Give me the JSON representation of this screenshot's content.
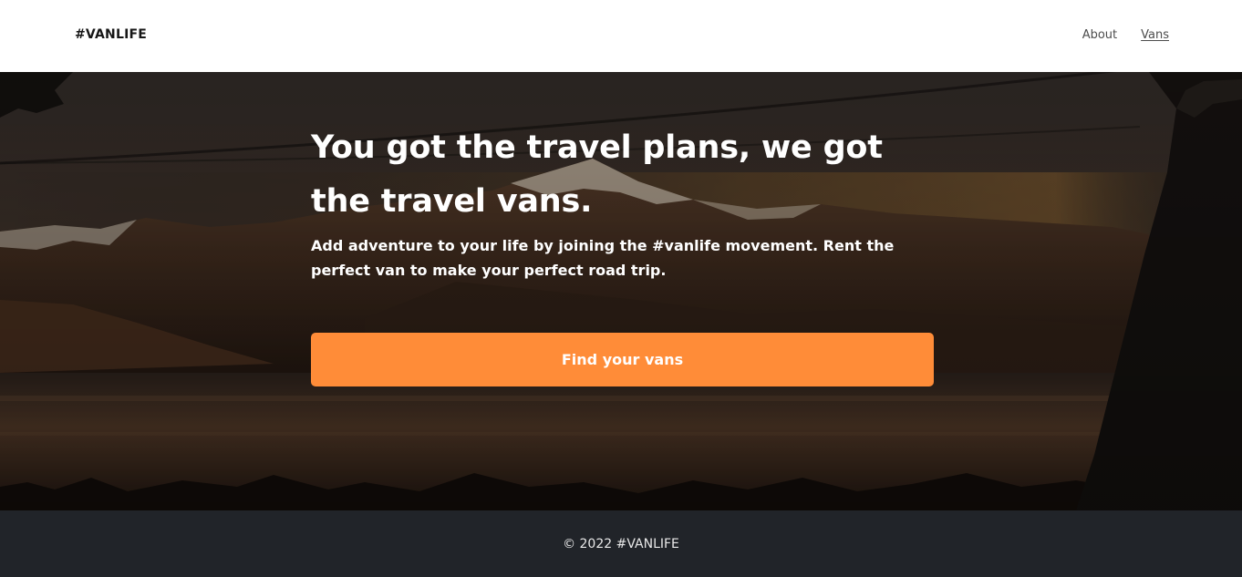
{
  "header": {
    "logo": "#VANLIFE",
    "nav": [
      {
        "label": "About"
      },
      {
        "label": "Vans"
      }
    ]
  },
  "hero": {
    "title": "You got the travel plans, we got the travel vans.",
    "subtitle": "Add adventure to your life by joining the #vanlife movement. Rent the perfect van to make your perfect road trip.",
    "cta_label": "Find your vans",
    "background_image": "dusk-mountain-lake-landscape"
  },
  "footer": {
    "text": "© 2022 #VANLIFE"
  },
  "colors": {
    "accent": "#FF8C38",
    "footer_bg": "#212429",
    "header_bg": "#FFFFFF"
  }
}
